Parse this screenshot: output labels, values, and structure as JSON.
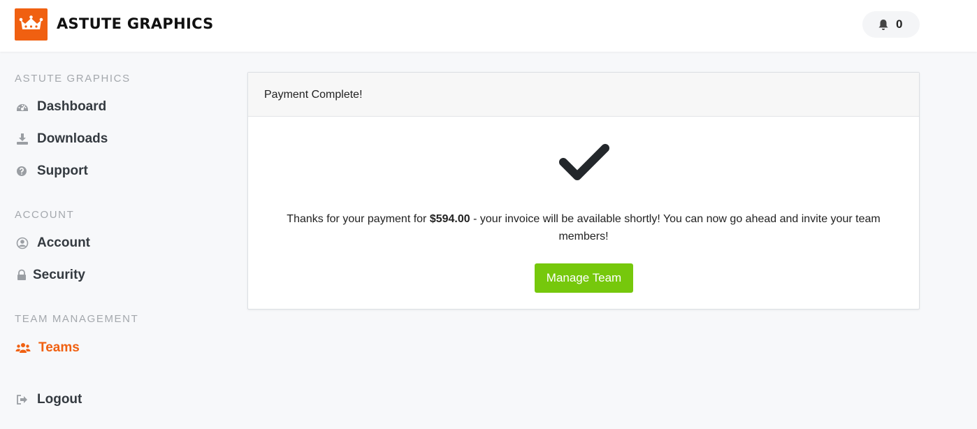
{
  "header": {
    "brand": "ASTUTE GRAPHICS",
    "logo_icon": "crown-icon",
    "notifications": {
      "icon": "bell-icon",
      "count": "0"
    }
  },
  "sidebar": {
    "sections": [
      {
        "title": "ASTUTE GRAPHICS",
        "items": [
          {
            "label": "Dashboard",
            "icon": "dashboard-icon"
          },
          {
            "label": "Downloads",
            "icon": "download-icon"
          },
          {
            "label": "Support",
            "icon": "question-circle-icon"
          }
        ]
      },
      {
        "title": "ACCOUNT",
        "items": [
          {
            "label": "Account",
            "icon": "user-circle-icon"
          },
          {
            "label": "Security",
            "icon": "lock-icon"
          }
        ]
      },
      {
        "title": "TEAM MANAGEMENT",
        "items": [
          {
            "label": "Teams",
            "icon": "users-icon",
            "active": true
          }
        ]
      }
    ],
    "logout": {
      "label": "Logout",
      "icon": "sign-out-icon"
    }
  },
  "card": {
    "title": "Payment Complete!",
    "icon": "checkmark-icon",
    "message_before": "Thanks for your payment for ",
    "amount": "$594.00",
    "message_after": " - your invoice will be available shortly! You can now go ahead and invite your team members!",
    "button_label": "Manage Team"
  },
  "colors": {
    "brand_orange": "#f06011",
    "button_green": "#76c80c",
    "text_dark": "#343a40",
    "section_gray": "#a4a8ad"
  }
}
